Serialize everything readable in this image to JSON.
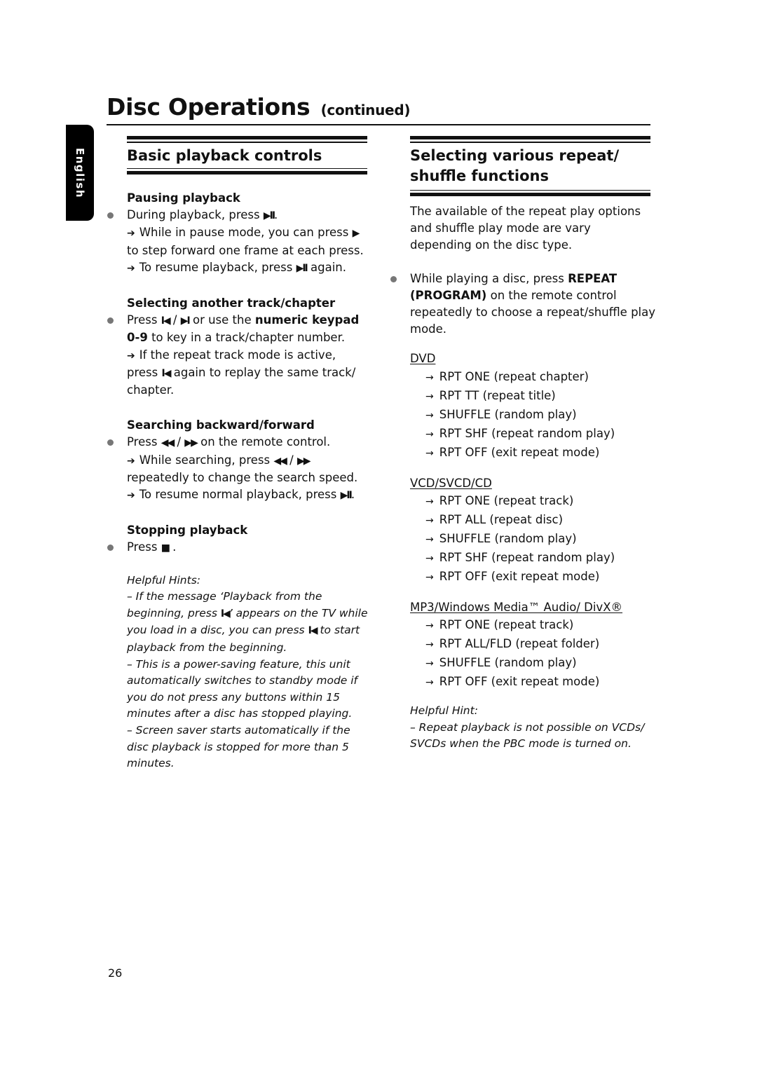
{
  "header": {
    "title": "Disc Operations",
    "title_suffix": "(continued)",
    "language_tab": "English"
  },
  "left": {
    "heading": "Basic playback controls",
    "pausing": {
      "title": "Pausing playback",
      "bullet_pre": "During playback, press",
      "bullet_icon": "▶II",
      "bullet_post": ".",
      "note1_pre": "While in pause mode, you can press",
      "note1_icon": "▶",
      "note1_post": "to step forward one frame at each press.",
      "note2_pre": "To resume playback, press",
      "note2_icon": "▶II",
      "note2_post": "again."
    },
    "selecting": {
      "title": "Selecting another track/chapter",
      "bullet_pre": "Press",
      "icon_prev": "I◀",
      "sep": "/",
      "icon_next": "▶I",
      "bullet_mid": "or use the",
      "bullet_bold": "numeric keypad 0-9",
      "bullet_post": "to key in a track/chapter number.",
      "note_pre": "If the repeat track mode is active, press",
      "note_icon": "I◀",
      "note_post": "again to replay the same track/ chapter."
    },
    "searching": {
      "title": "Searching backward/forward",
      "bullet_pre": "Press",
      "icon_rew": "◀◀",
      "sep": "/",
      "icon_ff": "▶▶",
      "bullet_post": "on the remote control.",
      "note1_pre": "While searching, press",
      "note1_post": "repeatedly to change the search speed.",
      "note2_pre": "To resume normal playback, press",
      "note2_icon": "▶II",
      "note2_post": "."
    },
    "stopping": {
      "title": "Stopping playback",
      "bullet_pre": "Press",
      "icon_stop": "■",
      "bullet_post": "."
    },
    "hints": {
      "title": "Helpful Hints:",
      "hint1_pre": "– If the message ‘Playback from the beginning, press",
      "hint1_icon": "I◀",
      "hint1_mid": "’ appears on the TV while you load in a disc, you can press",
      "hint1_post": "to  start playback from the beginning.",
      "hint2": "– This is a power-saving feature, this unit automatically switches to standby mode if you do not press any buttons within 15 minutes after a disc has stopped playing.",
      "hint3": "– Screen saver starts automatically if the disc playback is stopped for more than 5 minutes."
    }
  },
  "right": {
    "heading": "Selecting various repeat/ shuffle functions",
    "intro": "The available of the repeat play options and shuffle play mode are vary depending on the disc type.",
    "bullet_pre": "While playing a disc, press",
    "bullet_bold": "REPEAT (PROGRAM)",
    "bullet_post": "on the remote control repeatedly to choose a repeat/shuffle play mode.",
    "arrow": "→",
    "groups": [
      {
        "label": "DVD",
        "options": [
          "RPT ONE (repeat chapter)",
          "RPT TT (repeat title)",
          "SHUFFLE (random play)",
          "RPT SHF (repeat random play)",
          "RPT OFF (exit repeat mode)"
        ]
      },
      {
        "label": "VCD/SVCD/CD",
        "options": [
          "RPT ONE (repeat track)",
          "RPT ALL (repeat disc)",
          "SHUFFLE (random play)",
          "RPT SHF (repeat random play)",
          "RPT OFF (exit repeat mode)"
        ]
      },
      {
        "label": "MP3/Windows Media™ Audio/ DivX®",
        "options": [
          "RPT ONE (repeat track)",
          "RPT ALL/FLD (repeat folder)",
          "SHUFFLE (random play)",
          "RPT OFF (exit repeat mode)"
        ]
      }
    ],
    "hint_title": "Helpful Hint:",
    "hint": "– Repeat playback is not possible on VCDs/ SVCDs when the PBC mode is turned on."
  },
  "footer": {
    "page_number": "26"
  }
}
